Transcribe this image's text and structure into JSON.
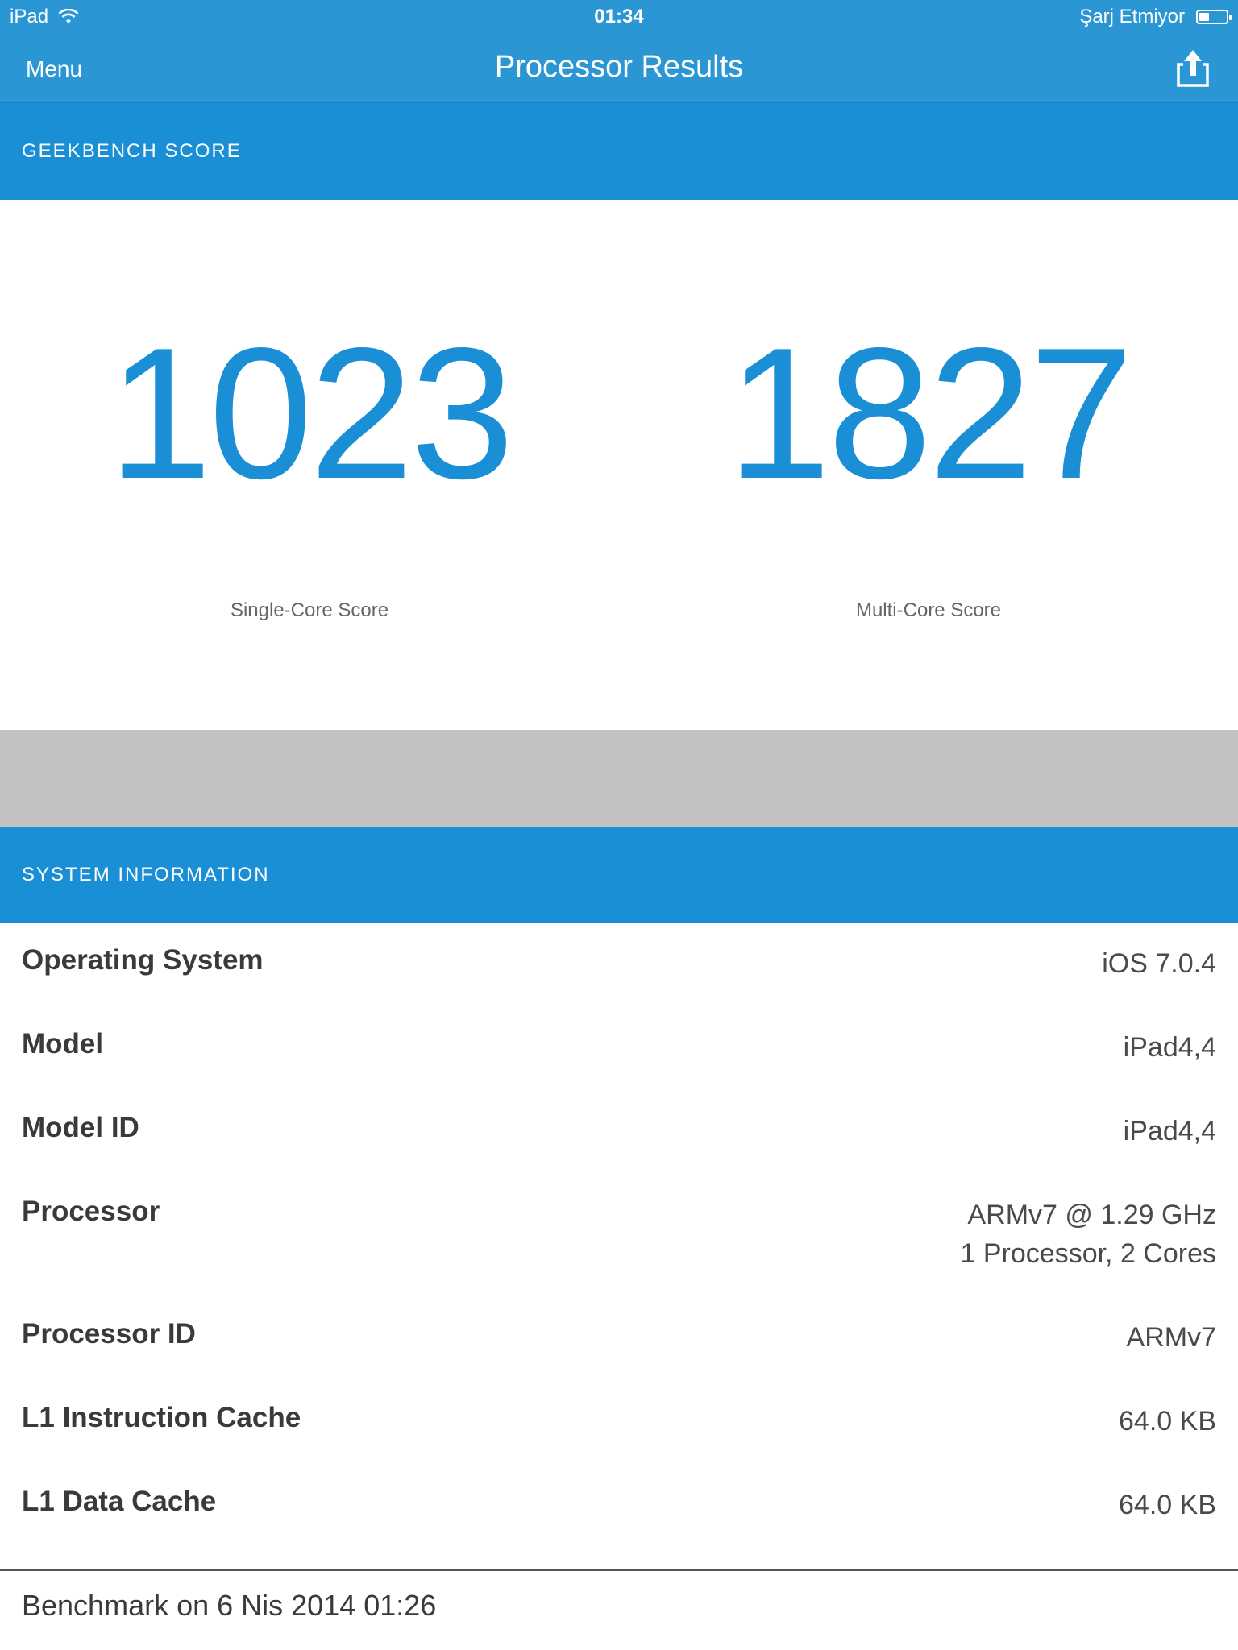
{
  "status_bar": {
    "device": "iPad",
    "time": "01:34",
    "charging": "Şarj Etmiyor"
  },
  "nav": {
    "menu_label": "Menu",
    "title": "Processor Results",
    "share_icon": "share-icon"
  },
  "score_section": {
    "header": "GEEKBENCH SCORE",
    "single_core": {
      "value": "1023",
      "label": "Single-Core Score"
    },
    "multi_core": {
      "value": "1827",
      "label": "Multi-Core Score"
    }
  },
  "system_section": {
    "header": "SYSTEM INFORMATION",
    "rows": [
      {
        "key": "Operating System",
        "value": "iOS 7.0.4"
      },
      {
        "key": "Model",
        "value": "iPad4,4"
      },
      {
        "key": "Model ID",
        "value": "iPad4,4"
      },
      {
        "key": "Processor",
        "value": "ARMv7 @ 1.29 GHz",
        "value2": "1 Processor, 2 Cores"
      },
      {
        "key": "Processor ID",
        "value": "ARMv7"
      },
      {
        "key": "L1 Instruction Cache",
        "value": "64.0 KB"
      },
      {
        "key": "L1 Data Cache",
        "value": "64.0 KB"
      }
    ]
  },
  "footer": {
    "benchmark_date": "Benchmark on 6 Nis 2014 01:26"
  },
  "colors": {
    "nav_blue": "#2a96d4",
    "section_blue": "#1a8fd5",
    "score_blue": "#1a8fd5",
    "gray_band": "#c2c2c2"
  }
}
